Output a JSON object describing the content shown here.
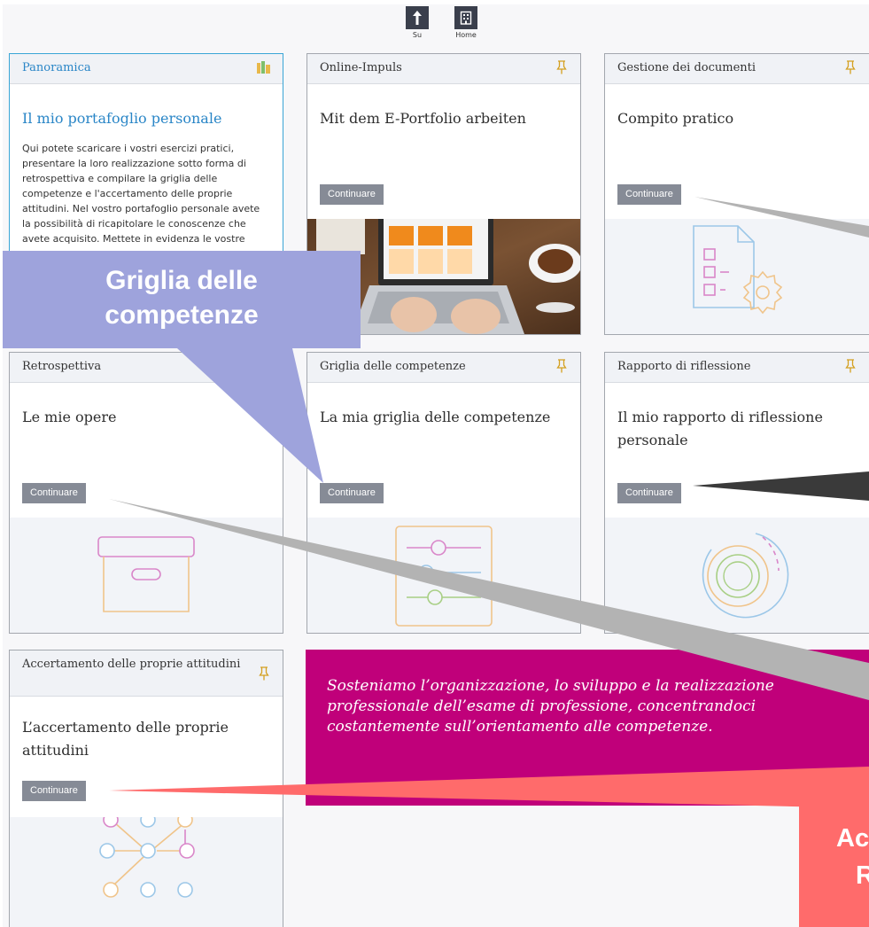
{
  "nav": {
    "up_label": "Su",
    "home_label": "Home"
  },
  "cards": [
    {
      "category": "Panoramica",
      "title": "Il mio portafoglio personale",
      "description": "Qui potete scaricare i vostri esercizi pratici, presentare la loro realizzazione sotto forma di retrospettiva e compilare la griglia delle competenze e l'accertamento delle proprie attitudini. Nel vostro portafoglio personale avete la possibilità di ricapitolare le conoscenze che avete acquisito. Mettete in evidenza le vostre"
    },
    {
      "category": "Online-Impuls",
      "title": "Mit dem E-Portfolio arbeiten",
      "button": "Continuare"
    },
    {
      "category": "Gestione dei documenti",
      "title": "Compito pratico",
      "button": "Continuare"
    },
    {
      "category": "Retrospettiva",
      "title": "Le mie opere",
      "button": "Continuare"
    },
    {
      "category": "Griglia delle competenze",
      "title": "La mia griglia delle competenze",
      "button": "Continuare"
    },
    {
      "category": "Rapporto di riflessione",
      "title": "Il mio rapporto di riflessione personale",
      "button": "Continuare"
    },
    {
      "category": "Accertamento delle proprie attitudini",
      "title": "L’accertamento delle proprie attitudini",
      "button": "Continuare"
    }
  ],
  "quote": "Sosteniamo l’organizzazione, lo sviluppo e la realizzazione professionale dell’esame di professione, concentrandoci costantemente sull’orientamento alle competenze.",
  "callouts": {
    "griglia_line1": "Griglia delle",
    "griglia_line2": "competenze",
    "red_line1": "Ac",
    "red_line2": "R"
  },
  "colors": {
    "accent_blue": "#2a86c7",
    "button_gray": "#868b96",
    "quote_magenta": "#c0007a",
    "callout_purple": "#9ea3dc",
    "callout_red": "#ff6b6b"
  },
  "icons": [
    "arrow-up-icon",
    "building-icon",
    "pin-icon",
    "books-icon"
  ]
}
